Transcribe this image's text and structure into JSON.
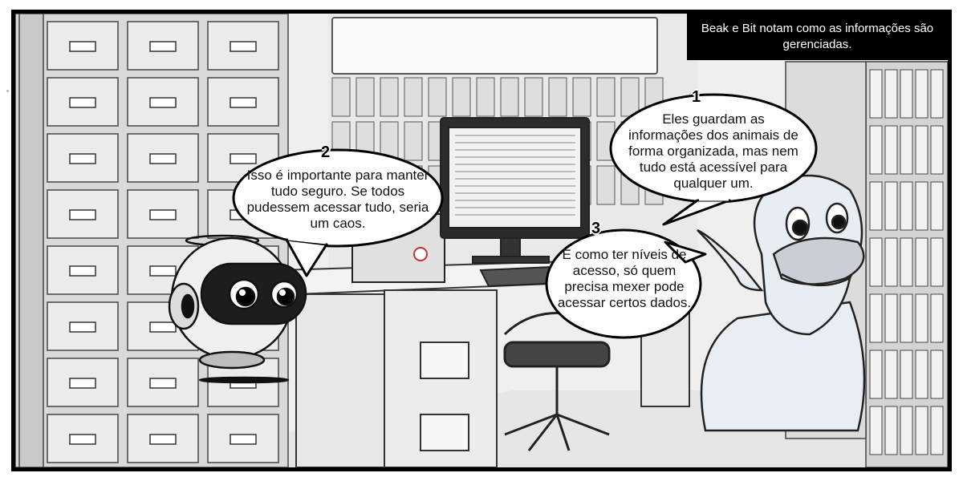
{
  "caption": "Beak e Bit notam como as informações são gerenciadas.",
  "bubbles": [
    {
      "number": "1",
      "text": "Eles guardam as informações dos animais de forma organizada, mas nem tudo está acessível para qualquer um."
    },
    {
      "number": "2",
      "text": "Isso é importante para manter tudo seguro. Se todos pudessem acessar tudo, seria um caos."
    },
    {
      "number": "3",
      "text": "É como ter níveis de acesso, só quem precisa mexer pode acessar certos dados."
    }
  ],
  "colors": {
    "frame": "#000000",
    "paper": "#efefef",
    "caption_bg": "#000000",
    "caption_text": "#ffffff"
  }
}
